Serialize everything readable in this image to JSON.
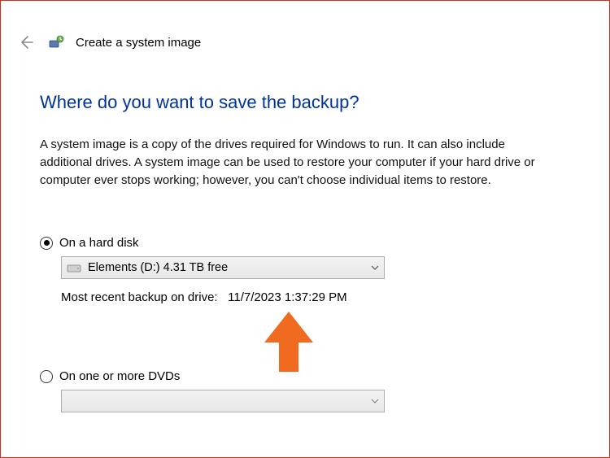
{
  "header": {
    "title": "Create a system image"
  },
  "page": {
    "heading": "Where do you want to save the backup?",
    "description": "A system image is a copy of the drives required for Windows to run. It can also include additional drives. A system image can be used to restore your computer if your hard drive or computer ever stops working; however, you can't choose individual items to restore."
  },
  "option_hard_disk": {
    "label": "On a hard disk",
    "selected_drive": "Elements (D:)  4.31 TB free",
    "recent_label": "Most recent backup on drive:",
    "recent_value": "11/7/2023 1:37:29 PM"
  },
  "option_dvd": {
    "label": "On one or more DVDs",
    "selected_drive": ""
  },
  "icons": {
    "back": "back-arrow-icon",
    "wizard": "system-image-icon",
    "drive": "hard-drive-icon",
    "caret": "chevron-down-icon"
  }
}
